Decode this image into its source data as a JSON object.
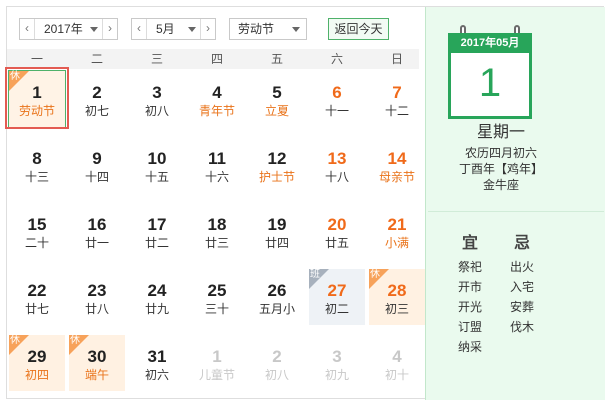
{
  "toolbar": {
    "year_value": "2017年",
    "month_value": "5月",
    "holiday_value": "劳动节",
    "today_button": "返回今天",
    "prev_icon": "chevron-left-icon",
    "next_icon": "chevron-right-icon"
  },
  "weekdays": [
    "一",
    "二",
    "三",
    "四",
    "五",
    "六",
    "日"
  ],
  "weeks": [
    [
      {
        "day": "1",
        "sub": "劳动节",
        "state": "selected fest",
        "tag": "休"
      },
      {
        "day": "2",
        "sub": "初七",
        "state": ""
      },
      {
        "day": "3",
        "sub": "初八",
        "state": ""
      },
      {
        "day": "4",
        "sub": "青年节",
        "state": "fest"
      },
      {
        "day": "5",
        "sub": "立夏",
        "state": "fest"
      },
      {
        "day": "6",
        "sub": "十一",
        "state": "weekend"
      },
      {
        "day": "7",
        "sub": "十二",
        "state": "weekend"
      }
    ],
    [
      {
        "day": "8",
        "sub": "十三",
        "state": ""
      },
      {
        "day": "9",
        "sub": "十四",
        "state": ""
      },
      {
        "day": "10",
        "sub": "十五",
        "state": ""
      },
      {
        "day": "11",
        "sub": "十六",
        "state": ""
      },
      {
        "day": "12",
        "sub": "护士节",
        "state": "fest"
      },
      {
        "day": "13",
        "sub": "十八",
        "state": "weekend"
      },
      {
        "day": "14",
        "sub": "母亲节",
        "state": "weekend fest"
      }
    ],
    [
      {
        "day": "15",
        "sub": "二十",
        "state": ""
      },
      {
        "day": "16",
        "sub": "廿一",
        "state": ""
      },
      {
        "day": "17",
        "sub": "廿二",
        "state": ""
      },
      {
        "day": "18",
        "sub": "廿三",
        "state": ""
      },
      {
        "day": "19",
        "sub": "廿四",
        "state": ""
      },
      {
        "day": "20",
        "sub": "廿五",
        "state": "weekend"
      },
      {
        "day": "21",
        "sub": "小满",
        "state": "weekend fest"
      }
    ],
    [
      {
        "day": "22",
        "sub": "廿七",
        "state": ""
      },
      {
        "day": "23",
        "sub": "廿八",
        "state": ""
      },
      {
        "day": "24",
        "sub": "廿九",
        "state": ""
      },
      {
        "day": "25",
        "sub": "三十",
        "state": ""
      },
      {
        "day": "26",
        "sub": "五月小",
        "state": ""
      },
      {
        "day": "27",
        "sub": "初二",
        "state": "weekend workday",
        "tag": "班"
      },
      {
        "day": "28",
        "sub": "初三",
        "state": "weekend holiday",
        "tag": "休"
      }
    ],
    [
      {
        "day": "29",
        "sub": "初四",
        "state": "holiday fest",
        "tag": "休"
      },
      {
        "day": "30",
        "sub": "端午",
        "state": "holiday fest",
        "tag": "休"
      },
      {
        "day": "31",
        "sub": "初六",
        "state": ""
      },
      {
        "day": "1",
        "sub": "儿童节",
        "state": "other"
      },
      {
        "day": "2",
        "sub": "初八",
        "state": "other"
      },
      {
        "day": "3",
        "sub": "初九",
        "state": "other"
      },
      {
        "day": "4",
        "sub": "初十",
        "state": "other"
      }
    ]
  ],
  "side": {
    "header": "2017年05月",
    "day": "1",
    "weekday": "星期一",
    "lunar": "农历四月初六",
    "ganzhi": "丁酉年【鸡年】",
    "zodiac": "金牛座",
    "yi_label": "宜",
    "ji_label": "忌",
    "yi_items": [
      "祭祀",
      "开市",
      "开光",
      "订盟",
      "纳采"
    ],
    "ji_items": [
      "出火",
      "入宅",
      "安葬",
      "伐木"
    ]
  },
  "colors": {
    "accent_green": "#28a55a",
    "weekend_orange": "#f06a1a",
    "holiday_bg": "#fff1e2",
    "selected_border": "#e35b52"
  }
}
